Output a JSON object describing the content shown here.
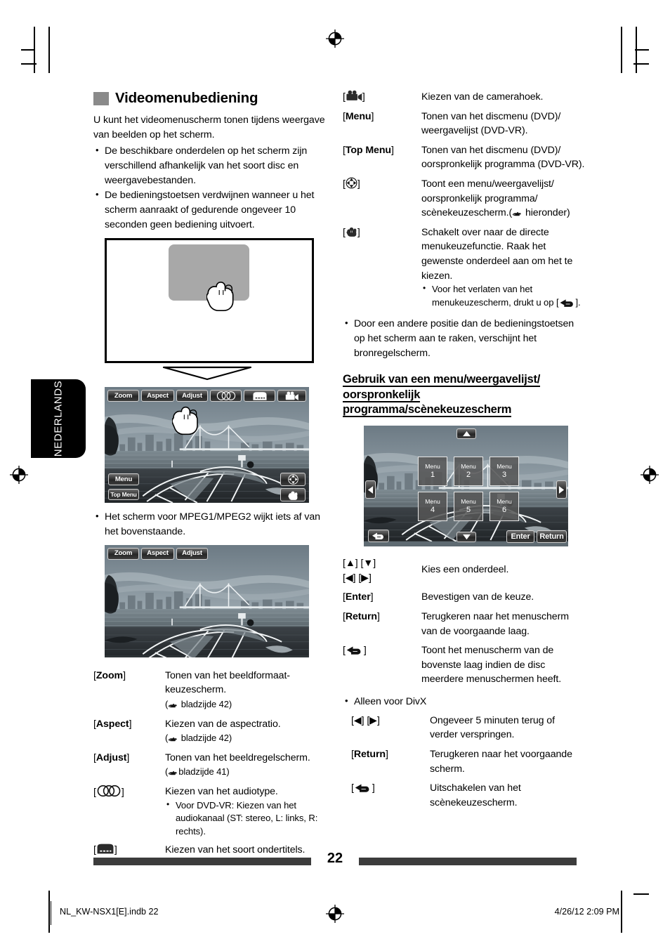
{
  "page": {
    "number": "22",
    "language_tab": "NEDERLANDS",
    "print_file": "NL_KW-NSX1[E].indb   22",
    "print_date": "4/26/12   2:09 PM"
  },
  "left_column": {
    "heading": "Videomenubediening",
    "intro": "U kunt het videomenuscherm tonen tijdens weergave van beelden op het scherm.",
    "intro_bullets": [
      "De beschikbare onderdelen op het scherm zijn verschillend afhankelijk van het soort disc en weergavebestanden.",
      "De bedieningstoetsen verdwijnen wanneer u het scherm aanraakt of gedurende ongeveer 10 seconden geen bediening uitvoert."
    ],
    "mpeg_note": "Het scherm voor MPEG1/MPEG2 wijkt iets af van het bovenstaande.",
    "main_screenshot": {
      "toolbar": [
        "Zoom",
        "Aspect",
        "Adjust"
      ],
      "toolbar_icons": [
        "audio-type-icon",
        "subtitle-icon",
        "camera-angle-icon"
      ],
      "menu_button": "Menu",
      "top_menu_button": "Top Menu",
      "corner_icons": [
        "dpad-icon",
        "hand-touch-icon"
      ]
    },
    "mpeg_screenshot": {
      "toolbar": [
        "Zoom",
        "Aspect",
        "Adjust"
      ]
    },
    "definitions": [
      {
        "key": "[Zoom]",
        "key_bold": "Zoom",
        "desc_line1": "Tonen van het beeldformaat-keuzescherm.",
        "desc_line2": "( bladzijde 42)"
      },
      {
        "key": "[Aspect]",
        "key_bold": "Aspect",
        "desc_line1": "Kiezen van de aspectratio.",
        "desc_line2": "( bladzijde 42)"
      },
      {
        "key": "[Adjust]",
        "key_bold": "Adjust",
        "desc_line1": "Tonen van het beeldregelscherm.",
        "desc_line2": "( bladzijde 41)"
      },
      {
        "key": "[audio-type-icon]",
        "key_bold": "",
        "desc_line1": "Kiezen van het audiotype.",
        "desc_line2": "",
        "sub_bullets": [
          "Voor DVD-VR: Kiezen van het audiokanaal (ST: stereo, L: links, R: rechts)."
        ]
      },
      {
        "key": "[subtitle-icon]",
        "key_bold": "",
        "desc_line1": "Kiezen van het soort ondertitels.",
        "desc_line2": ""
      }
    ]
  },
  "right_column": {
    "definitions_top": [
      {
        "key": "[camera-angle-icon]",
        "key_bold": "",
        "desc": "Kiezen van de camerahoek."
      },
      {
        "key": "[Menu]",
        "key_bold": "Menu",
        "desc": "Tonen van het discmenu (DVD)/ weergavelijst (DVD-VR)."
      },
      {
        "key": "[Top Menu]",
        "key_bold": "Top Menu",
        "desc": "Tonen van het discmenu (DVD)/ oorspronkelijk programma (DVD-VR)."
      },
      {
        "key": "[dpad-icon]",
        "key_bold": "",
        "desc": "Toont een menu/weergavelijst/ oorspronkelijk programma/ scènekeuzescherm.( hieronder)"
      },
      {
        "key": "[hand-touch-icon]",
        "key_bold": "",
        "desc": "Schakelt over naar de directe menukeuzefunctie. Raak het gewenste onderdeel aan om het te kiezen.",
        "sub_bullets_pre": "Voor het verlaten van het menukeuzescherm, drukt u op [",
        "sub_bullets_post": "]."
      }
    ],
    "note_bullet": "Door een andere positie dan de bedieningstoetsen op het scherm aan te raken, verschijnt het bronregelscherm.",
    "sub_heading_line1": "Gebruik van een menu/weergavelijst/",
    "sub_heading_line2": "oorspronkelijk programma/scènekeuzescherm",
    "menu_screenshot": {
      "items": [
        {
          "label": "Menu",
          "num": "1"
        },
        {
          "label": "Menu",
          "num": "2"
        },
        {
          "label": "Menu",
          "num": "3"
        },
        {
          "label": "Menu",
          "num": "4"
        },
        {
          "label": "Menu",
          "num": "5"
        },
        {
          "label": "Menu",
          "num": "6"
        }
      ],
      "enter_button": "Enter",
      "return_button": "Return",
      "nav_icons": [
        "arrow-up-icon",
        "arrow-down-icon",
        "arrow-left-icon",
        "arrow-right-icon",
        "back-return-icon"
      ]
    },
    "definitions_bottom": [
      {
        "key": "[▲] [▼]",
        "key2": "[◀] [▶]",
        "key_bold": "",
        "desc": "Kies een onderdeel."
      },
      {
        "key": "[Enter]",
        "key_bold": "Enter",
        "desc": "Bevestigen van de keuze."
      },
      {
        "key": "[Return]",
        "key_bold": "Return",
        "desc": "Terugkeren naar het menuscherm van de voorgaande laag."
      },
      {
        "key": "[back-return-icon]",
        "key_bold": "",
        "desc": "Toont het menuscherm van de bovenste laag indien de disc meerdere menuschermen heeft."
      }
    ],
    "divx_note": "Alleen voor DivX",
    "definitions_divx": [
      {
        "key": "[◀] [▶]",
        "key_bold": "",
        "desc": "Ongeveer 5 minuten terug of verder verspringen."
      },
      {
        "key": "[Return]",
        "key_bold": "Return",
        "desc": "Terugkeren naar het voorgaande scherm."
      },
      {
        "key": "[back-return-icon]",
        "key_bold": "",
        "desc": "Uitschakelen van het scènekeuzescherm."
      }
    ]
  }
}
